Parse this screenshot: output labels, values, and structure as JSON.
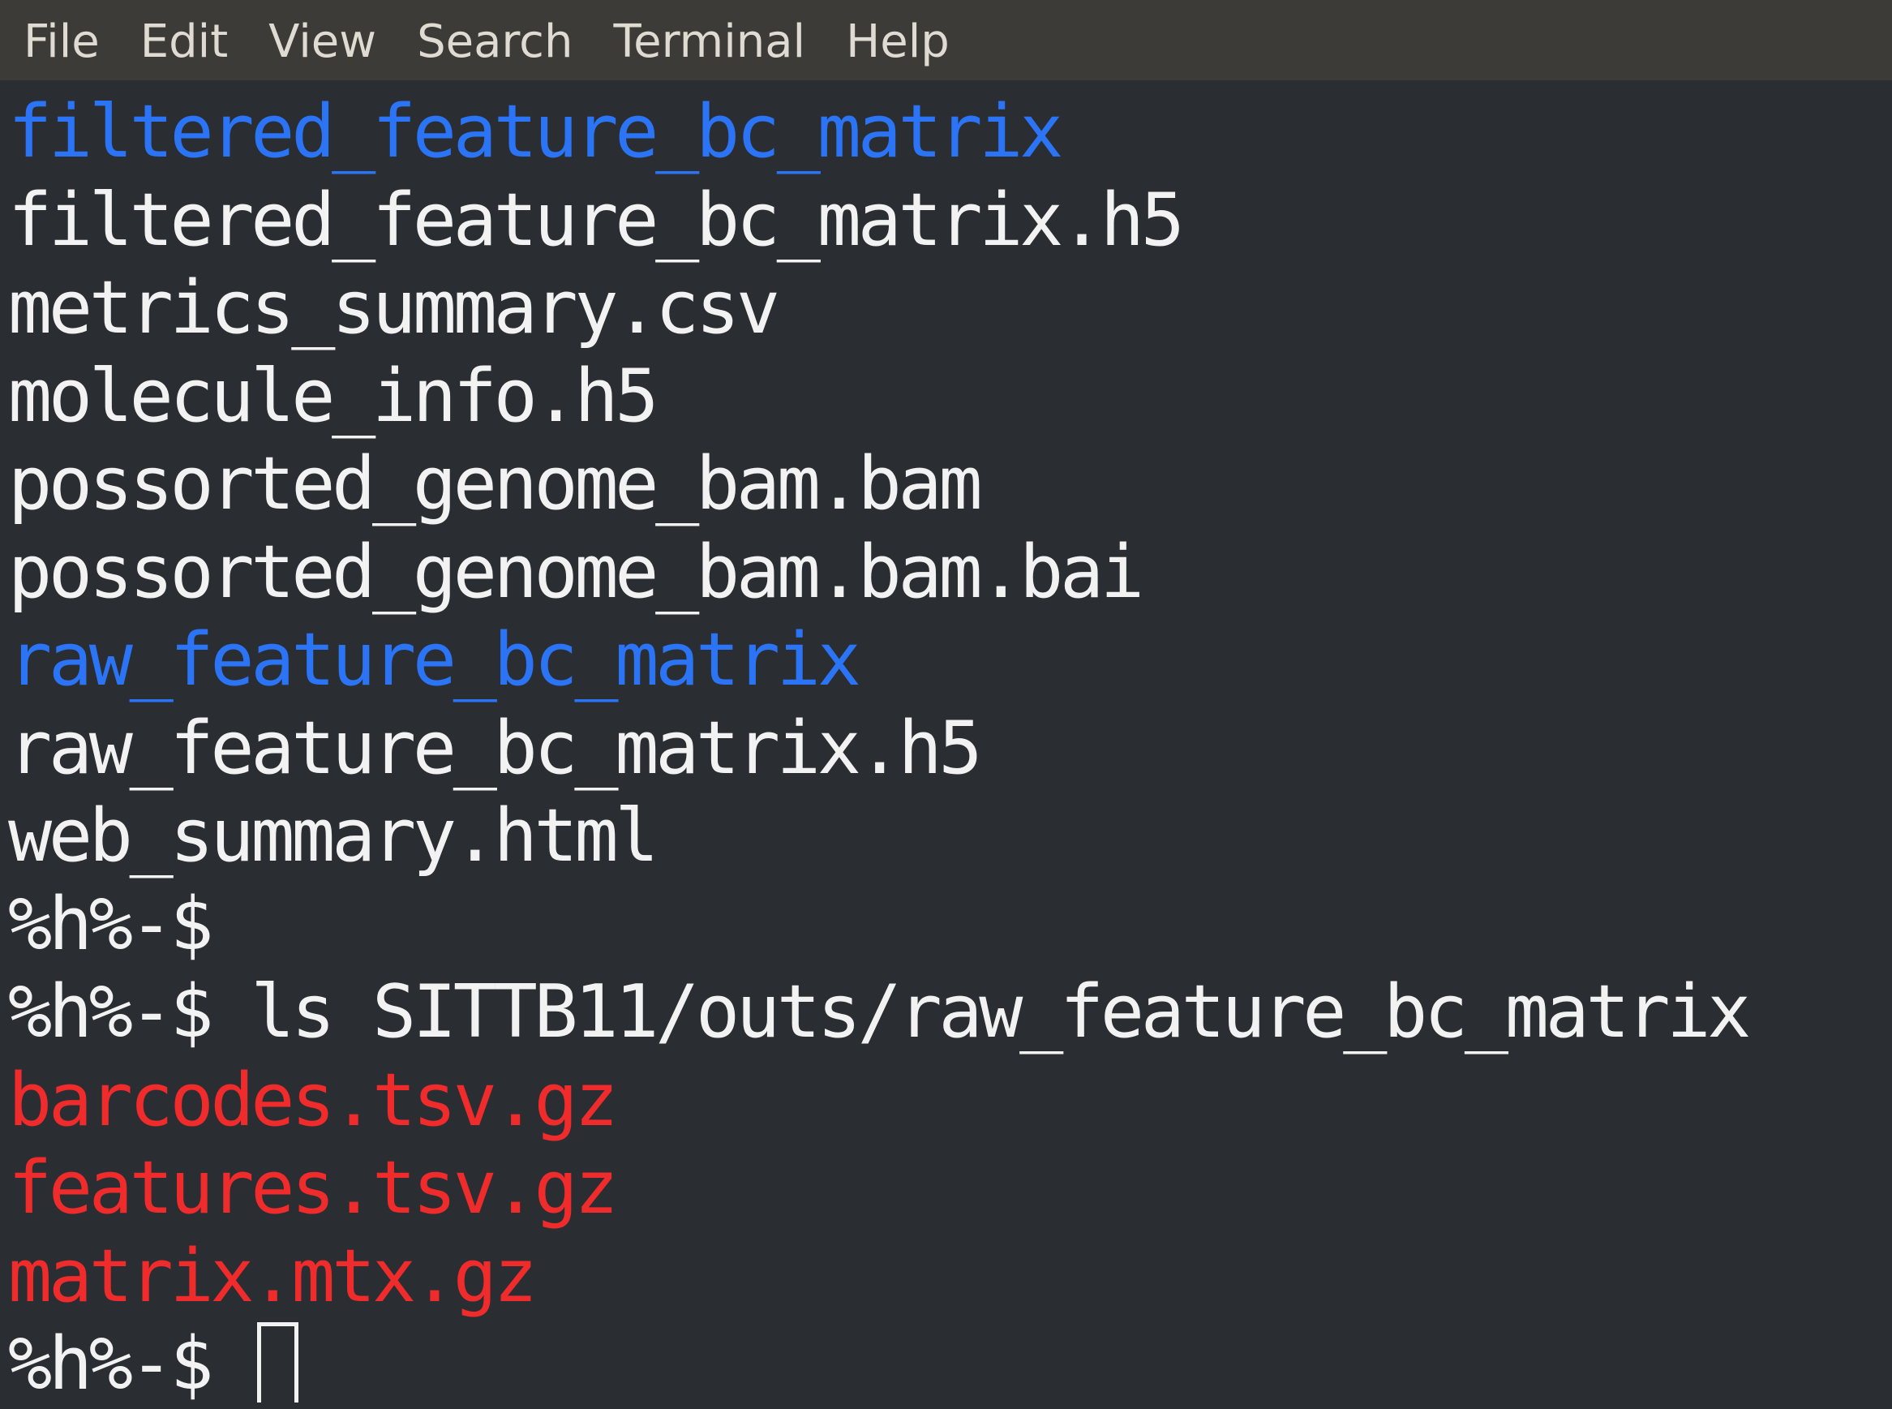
{
  "menubar": {
    "items": [
      "File",
      "Edit",
      "View",
      "Search",
      "Terminal",
      "Help"
    ]
  },
  "terminal": {
    "prompt": "%h%-$",
    "lines": [
      {
        "text": "filtered_feature_bc_matrix",
        "kind": "directory"
      },
      {
        "text": "filtered_feature_bc_matrix.h5",
        "kind": "file"
      },
      {
        "text": "metrics_summary.csv",
        "kind": "file"
      },
      {
        "text": "molecule_info.h5",
        "kind": "file"
      },
      {
        "text": "possorted_genome_bam.bam",
        "kind": "file"
      },
      {
        "text": "possorted_genome_bam.bam.bai",
        "kind": "file"
      },
      {
        "text": "raw_feature_bc_matrix",
        "kind": "directory"
      },
      {
        "text": "raw_feature_bc_matrix.h5",
        "kind": "file"
      },
      {
        "text": "web_summary.html",
        "kind": "file"
      },
      {
        "text": "%h%-$",
        "kind": "prompt"
      },
      {
        "text": "%h%-$ ls SITTB11/outs/raw_feature_bc_matrix",
        "kind": "command"
      },
      {
        "text": "barcodes.tsv.gz",
        "kind": "archive"
      },
      {
        "text": "features.tsv.gz",
        "kind": "archive"
      },
      {
        "text": "matrix.mtx.gz",
        "kind": "archive"
      }
    ],
    "colors": {
      "background": "#2a2e33",
      "menubar": "#3c3b37",
      "text": "#f2f2f2",
      "directory": "#2b74f5",
      "archive": "#ef2b2b"
    }
  }
}
